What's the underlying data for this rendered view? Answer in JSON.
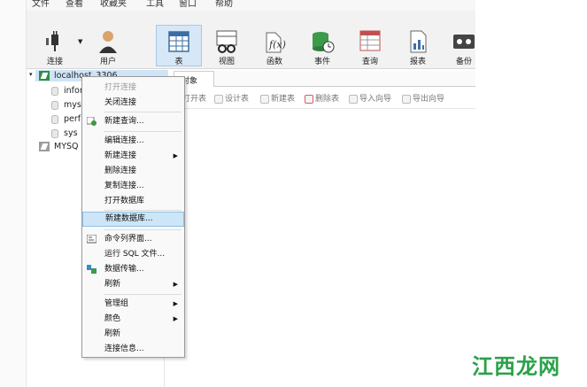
{
  "menubar": [
    "文件",
    "查看",
    "收藏夹",
    "工具",
    "窗口",
    "帮助"
  ],
  "toolbar": {
    "connect": "连接",
    "user": "用户",
    "table": "表",
    "view": "视图",
    "function": "函数",
    "event": "事件",
    "query": "查询",
    "report": "报表",
    "backup": "备份"
  },
  "tree": {
    "connection": "localhost_3306",
    "dbs": [
      "infor",
      "mys",
      "perf",
      "sys"
    ],
    "other": "MYSQ"
  },
  "object_tab": "对象",
  "object_tools": [
    "打开表",
    "设计表",
    "新建表",
    "删除表",
    "导入向导",
    "导出向导"
  ],
  "context_menu": {
    "open": "打开连接",
    "close": "关闭连接",
    "new_query": "新建查询...",
    "edit_conn": "编辑连接...",
    "new_conn": "新建连接",
    "delete_conn": "删除连接",
    "copy_conn": "复制连接...",
    "open_db": "打开数据库",
    "new_db": "新建数据库...",
    "cmd": "命令列界面...",
    "run_sql": "运行 SQL 文件...",
    "transfer": "数据传输...",
    "refresh1": "刷新",
    "manage": "管理组",
    "color": "颜色",
    "refresh2": "刷新",
    "info": "连接信息..."
  },
  "watermark": "江西龙网",
  "colors": {
    "accent": "#cde6f7",
    "brand": "#2aa14a"
  }
}
